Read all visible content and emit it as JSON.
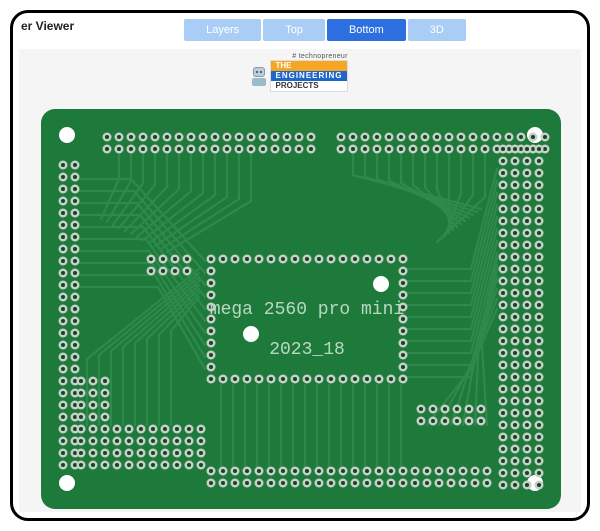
{
  "header": {
    "title_fragment": "er Viewer",
    "tabs": [
      {
        "label": "Layers",
        "active": false
      },
      {
        "label": "Top",
        "active": false
      },
      {
        "label": "Bottom",
        "active": true
      },
      {
        "label": "3D",
        "active": false
      }
    ]
  },
  "branding": {
    "tagline": "# technopreneur",
    "line1": "THE",
    "line2": "ENGINEERING",
    "line3": "PROJECTS"
  },
  "board": {
    "name_text": "mega 2560 pro mini",
    "revision_text": "2023_18",
    "soldermask_color": "#1e7a3a",
    "pad_annulus_color": "#c9cfc9",
    "pad_hole_color": "#0e4a22",
    "mounting_hole_color": "#ffffff",
    "trace_color": "#2e8a4a"
  }
}
